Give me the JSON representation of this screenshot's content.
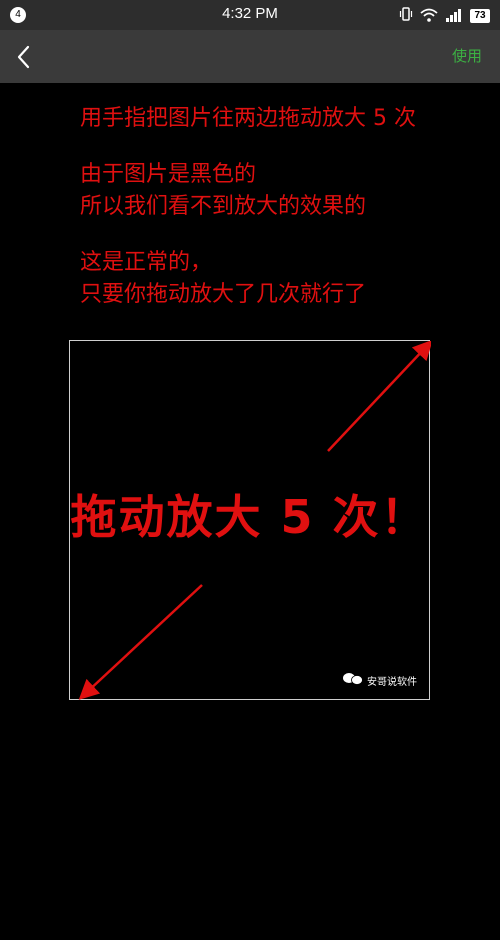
{
  "status_bar": {
    "notification_count": "4",
    "time": "4:32 PM",
    "battery": "73",
    "icons": [
      "vibrate-icon",
      "wifi-icon",
      "signal-icon"
    ]
  },
  "app_bar": {
    "back_icon": "chevron-left-icon",
    "use_label": "使用"
  },
  "instructions": {
    "line1": "用手指把图片往两边拖动放大 5 次",
    "line2": "由于图片是黑色的",
    "line3": "所以我们看不到放大的效果的",
    "line4": "这是正常的，",
    "line5": "只要你拖动放大了几次就行了"
  },
  "image": {
    "headline": "拖动放大 5 次！",
    "watermark": "安哥说软件",
    "accent_color": "#e01010"
  }
}
